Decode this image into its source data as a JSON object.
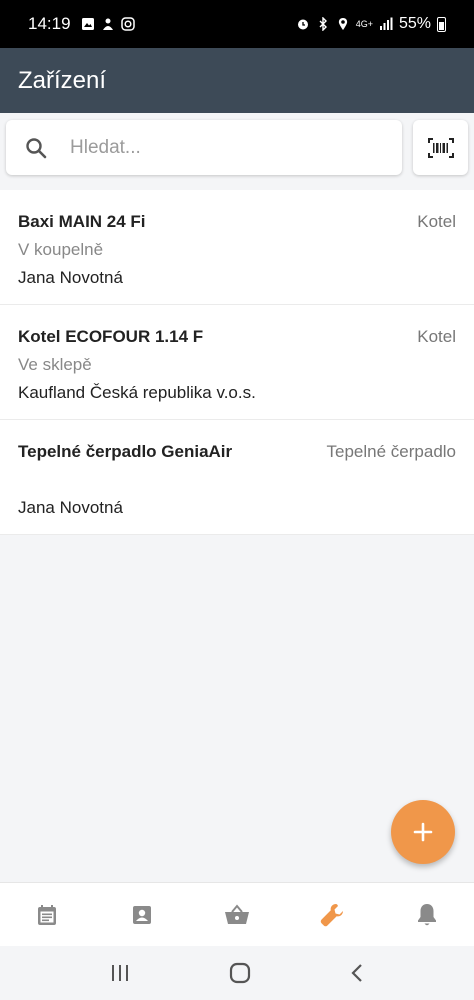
{
  "status_bar": {
    "time": "14:19",
    "battery": "55%",
    "network": "4G+"
  },
  "app_bar": {
    "title": "Zařízení"
  },
  "search": {
    "placeholder": "Hledat..."
  },
  "devices": [
    {
      "name": "Baxi MAIN 24 Fi",
      "type": "Kotel",
      "location": "V koupelně",
      "owner": "Jana Novotná"
    },
    {
      "name": "Kotel ECOFOUR 1.14 F",
      "type": "Kotel",
      "location": "Ve sklepě",
      "owner": "Kaufland Česká republika v.o.s."
    },
    {
      "name": "Tepelné čerpadlo GeniaAir",
      "type": "Tepelné čerpadlo",
      "location": "",
      "owner": "Jana Novotná"
    }
  ],
  "bottom_nav": [
    {
      "icon": "calendar-icon",
      "active": false
    },
    {
      "icon": "contact-icon",
      "active": false
    },
    {
      "icon": "basket-icon",
      "active": false
    },
    {
      "icon": "wrench-icon",
      "active": true
    },
    {
      "icon": "bell-icon",
      "active": false
    }
  ],
  "colors": {
    "app_bar": "#3d4a57",
    "accent": "#f0974a",
    "inactive_icon": "#8a8a8a"
  }
}
